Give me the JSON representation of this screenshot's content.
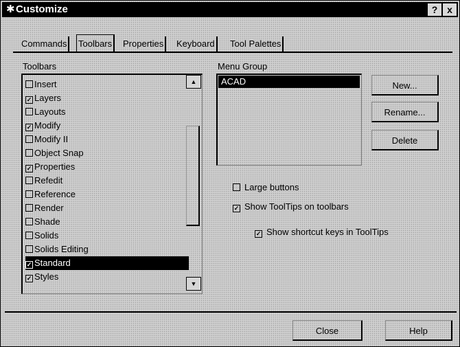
{
  "window": {
    "title": "Customize",
    "icon": "customize-star-icon",
    "help_label": "?",
    "close_label": "x"
  },
  "tabs": [
    {
      "label": "Commands",
      "active": false
    },
    {
      "label": "Toolbars",
      "active": true
    },
    {
      "label": "Properties",
      "active": false
    },
    {
      "label": "Keyboard",
      "active": false
    },
    {
      "label": "Tool Palettes",
      "active": false
    }
  ],
  "toolbars": {
    "label": "Toolbars",
    "items": [
      {
        "label": "Insert",
        "checked": false,
        "selected": false
      },
      {
        "label": "Layers",
        "checked": true,
        "selected": false
      },
      {
        "label": "Layouts",
        "checked": false,
        "selected": false
      },
      {
        "label": "Modify",
        "checked": true,
        "selected": false
      },
      {
        "label": "Modify II",
        "checked": false,
        "selected": false
      },
      {
        "label": "Object Snap",
        "checked": false,
        "selected": false
      },
      {
        "label": "Properties",
        "checked": true,
        "selected": false
      },
      {
        "label": "Refedit",
        "checked": false,
        "selected": false
      },
      {
        "label": "Reference",
        "checked": false,
        "selected": false
      },
      {
        "label": "Render",
        "checked": false,
        "selected": false
      },
      {
        "label": "Shade",
        "checked": false,
        "selected": false
      },
      {
        "label": "Solids",
        "checked": false,
        "selected": false
      },
      {
        "label": "Solids Editing",
        "checked": false,
        "selected": false
      },
      {
        "label": "Standard",
        "checked": true,
        "selected": true
      },
      {
        "label": "Styles",
        "checked": true,
        "selected": false
      }
    ]
  },
  "menu_group": {
    "label": "Menu Group",
    "items": [
      {
        "label": "ACAD",
        "selected": true
      }
    ]
  },
  "buttons": {
    "new": "New...",
    "rename": "Rename...",
    "delete": "Delete",
    "close": "Close",
    "help": "Help"
  },
  "options": [
    {
      "label": "Large buttons",
      "checked": false
    },
    {
      "label": "Show ToolTips on toolbars",
      "checked": true
    },
    {
      "label": "Show shortcut keys in ToolTips",
      "checked": true
    }
  ],
  "scrollbar": {
    "up_icon": "scroll-up-arrow-icon",
    "down_icon": "scroll-down-arrow-icon"
  }
}
